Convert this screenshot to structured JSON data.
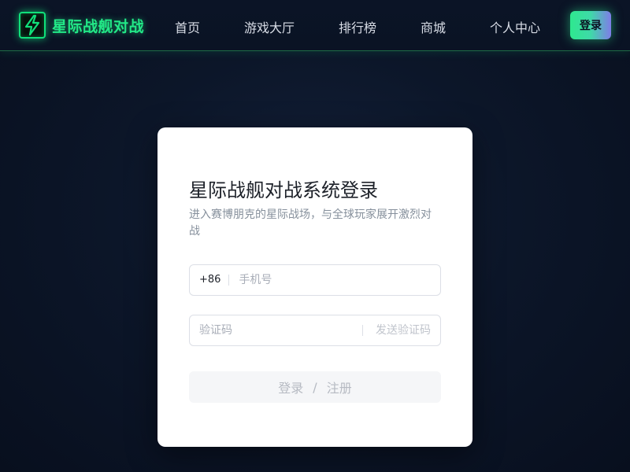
{
  "header": {
    "brand_name": "星际战舰对战",
    "logo_icon": "lightning-icon",
    "nav": [
      {
        "label": "首页"
      },
      {
        "label": "游戏大厅"
      },
      {
        "label": "排行榜"
      },
      {
        "label": "商城"
      },
      {
        "label": "个人中心"
      }
    ],
    "login_label": "登录"
  },
  "login_card": {
    "title": "星际战舰对战系统登录",
    "subtitle": "进入赛博朋克的星际战场，与全球玩家展开激烈对战",
    "phone": {
      "prefix": "+86",
      "placeholder": "手机号",
      "value": ""
    },
    "code": {
      "placeholder": "验证码",
      "value": "",
      "send_label": "发送验证码"
    },
    "submit": {
      "login": "登录",
      "separator": "/",
      "register": "注册"
    }
  },
  "colors": {
    "accent_green": "#22e887",
    "background": "#0c1629",
    "card": "#ffffff"
  }
}
